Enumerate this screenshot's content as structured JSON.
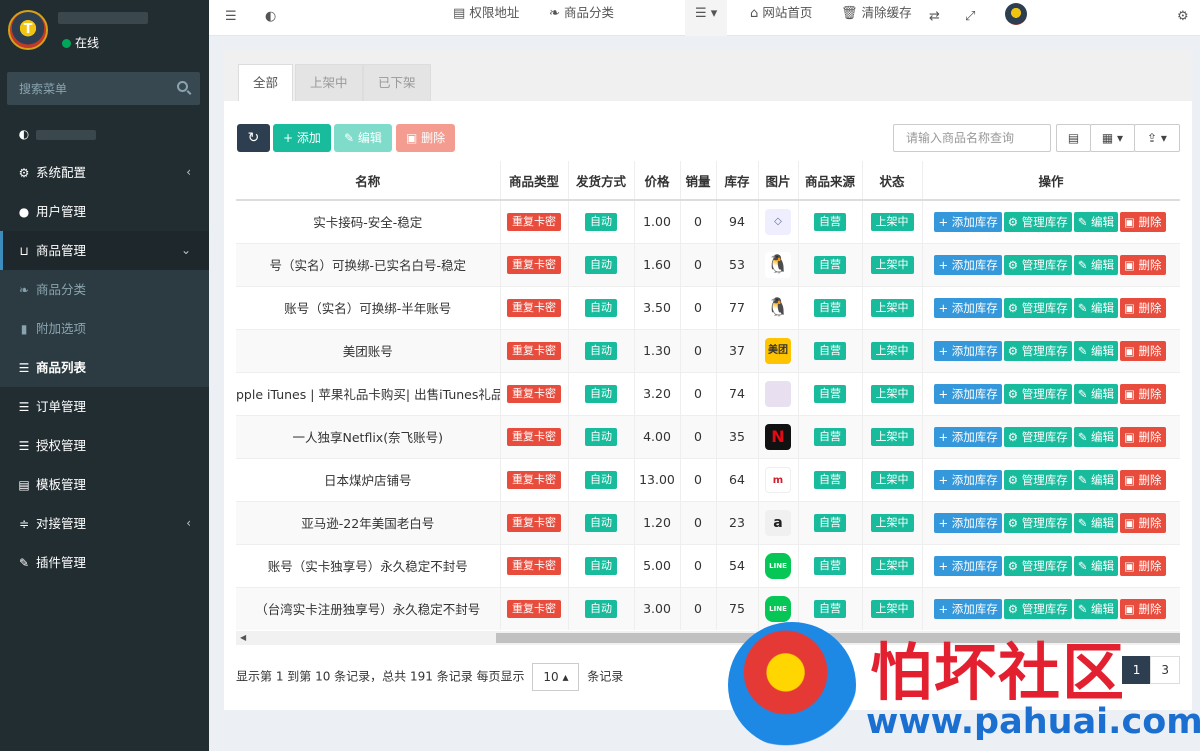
{
  "user": {
    "status": "在线"
  },
  "sidebar": {
    "search_placeholder": "搜索菜单",
    "items": [
      {
        "label": "系统配置",
        "icon": "gear-icon",
        "caret": "‹"
      },
      {
        "label": "用户管理",
        "icon": "user-icon"
      },
      {
        "label": "商品管理",
        "icon": "cart-icon",
        "caret": "⌄"
      },
      {
        "label": "订单管理",
        "icon": "list-icon"
      },
      {
        "label": "授权管理",
        "icon": "list-icon"
      },
      {
        "label": "模板管理",
        "icon": "template-icon"
      },
      {
        "label": "对接管理",
        "icon": "sliders-icon",
        "caret": "‹"
      },
      {
        "label": "插件管理",
        "icon": "plug-icon"
      }
    ],
    "submenu": [
      {
        "label": "商品分类",
        "icon": "leaf-icon"
      },
      {
        "label": "附加选项",
        "icon": "bookmark-icon"
      },
      {
        "label": "商品列表",
        "icon": "list-icon"
      }
    ]
  },
  "header": {
    "auth_url": "权限地址",
    "category": "商品分类",
    "home": "网站首页",
    "clear_cache": "清除缓存"
  },
  "tabs": [
    "全部",
    "上架中",
    "已下架"
  ],
  "toolbar": {
    "add": "添加",
    "edit": "编辑",
    "delete": "删除",
    "search_placeholder": "请输入商品名称查询"
  },
  "table": {
    "columns": [
      "名称",
      "商品类型",
      "发货方式",
      "价格",
      "销量",
      "库存",
      "图片",
      "商品来源",
      "状态",
      "操作"
    ],
    "rows": [
      {
        "name": "实卡接码-安全-稳定",
        "type": "重复卡密",
        "ship": "自动",
        "price": "1.00",
        "sales": "0",
        "stock": "94",
        "pic": "gen",
        "source": "自营",
        "status": "上架中"
      },
      {
        "name": "号（实名）可换绑-已实名白号-稳定",
        "type": "重复卡密",
        "ship": "自动",
        "price": "1.60",
        "sales": "0",
        "stock": "53",
        "pic": "qq",
        "source": "自营",
        "status": "上架中"
      },
      {
        "name": "账号（实名）可换绑-半年账号",
        "type": "重复卡密",
        "ship": "自动",
        "price": "3.50",
        "sales": "0",
        "stock": "77",
        "pic": "qq",
        "source": "自营",
        "status": "上架中"
      },
      {
        "name": "美团账号",
        "type": "重复卡密",
        "ship": "自动",
        "price": "1.30",
        "sales": "0",
        "stock": "37",
        "pic": "mt",
        "source": "自营",
        "status": "上架中"
      },
      {
        "name": "pple iTunes | 苹果礼品卡购买| 出售iTunes礼品卡|",
        "type": "重复卡密",
        "ship": "自动",
        "price": "3.20",
        "sales": "0",
        "stock": "74",
        "pic": "apple",
        "source": "自营",
        "status": "上架中"
      },
      {
        "name": "一人独享Netflix(奈飞账号)",
        "type": "重复卡密",
        "ship": "自动",
        "price": "4.00",
        "sales": "0",
        "stock": "35",
        "pic": "nf",
        "source": "自营",
        "status": "上架中"
      },
      {
        "name": "日本煤炉店铺号",
        "type": "重复卡密",
        "ship": "自动",
        "price": "13.00",
        "sales": "0",
        "stock": "64",
        "pic": "mer",
        "source": "自营",
        "status": "上架中"
      },
      {
        "name": "亚马逊-22年美国老白号",
        "type": "重复卡密",
        "ship": "自动",
        "price": "1.20",
        "sales": "0",
        "stock": "23",
        "pic": "amz",
        "source": "自营",
        "status": "上架中"
      },
      {
        "name": "账号（实卡独享号）永久稳定不封号",
        "type": "重复卡密",
        "ship": "自动",
        "price": "5.00",
        "sales": "0",
        "stock": "54",
        "pic": "line",
        "source": "自营",
        "status": "上架中"
      },
      {
        "name": "（台湾实卡注册独享号）永久稳定不封号",
        "type": "重复卡密",
        "ship": "自动",
        "price": "3.00",
        "sales": "0",
        "stock": "75",
        "pic": "line",
        "source": "自营",
        "status": "上架中"
      }
    ],
    "ops": [
      "添加库存",
      "管理库存",
      "编辑",
      "删除"
    ]
  },
  "footer": {
    "text_before": "显示第 1 到第 10 条记录，总共 191 条记录 每页显示",
    "page_size": "10",
    "text_after": "条记录"
  },
  "pager": [
    "1",
    "3"
  ],
  "watermark": {
    "cn": "怕坏社区",
    "url": "www.pahuai.com"
  }
}
